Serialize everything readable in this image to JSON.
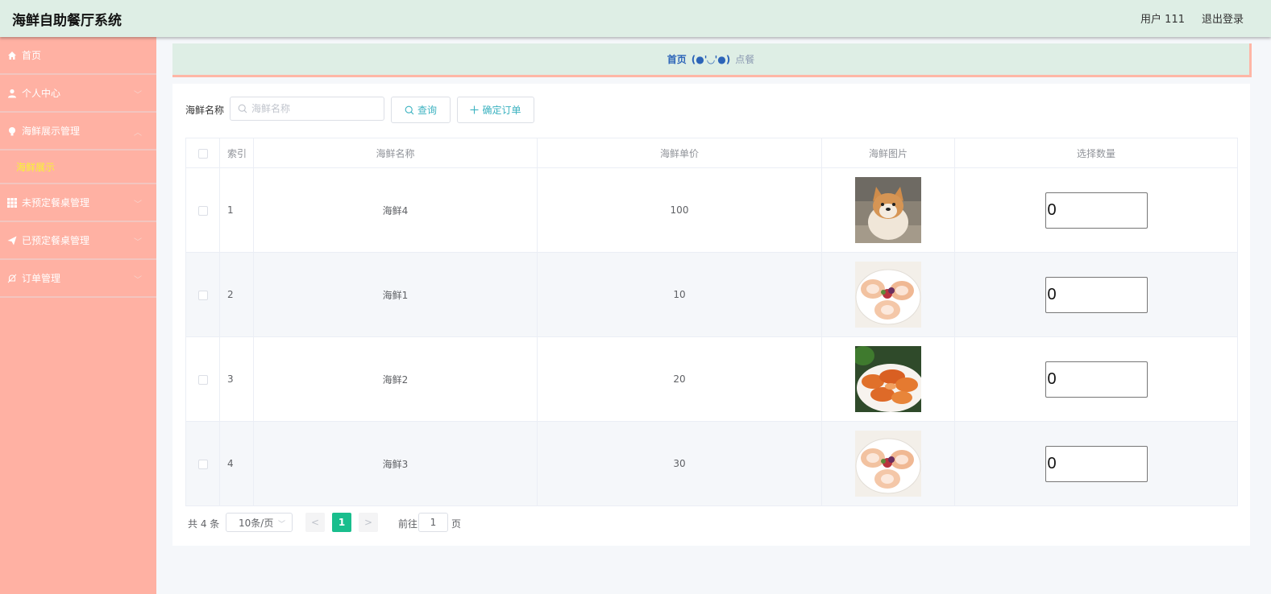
{
  "header": {
    "title": "海鲜自助餐厅系统",
    "user": "用户 111",
    "logout": "退出登录"
  },
  "sidebar": {
    "items": [
      {
        "label": "首页",
        "icon": "home-icon"
      },
      {
        "label": "个人中心",
        "icon": "user-icon"
      },
      {
        "label": "海鲜展示管理",
        "icon": "bulb-icon"
      },
      {
        "label": "未预定餐桌管理",
        "icon": "grid-icon"
      },
      {
        "label": "已预定餐桌管理",
        "icon": "send-icon"
      },
      {
        "label": "订单管理",
        "icon": "bell-off-icon"
      }
    ],
    "subitem": "海鲜展示"
  },
  "breadcrumb": {
    "home": "首页",
    "face": "(●'◡'●)",
    "current": "点餐"
  },
  "search": {
    "label": "海鲜名称",
    "placeholder": "海鲜名称",
    "query_button": "查询",
    "order_button": "确定订单"
  },
  "table": {
    "headers": [
      "索引",
      "海鲜名称",
      "海鲜单价",
      "海鲜图片",
      "选择数量"
    ],
    "rows": [
      {
        "index": "1",
        "name": "海鲜4",
        "price": "100",
        "image": "shiba-dog",
        "qty": "0"
      },
      {
        "index": "2",
        "name": "海鲜1",
        "price": "10",
        "image": "scallop-plate",
        "qty": "0"
      },
      {
        "index": "3",
        "name": "海鲜2",
        "price": "20",
        "image": "shrimp-plate",
        "qty": "0"
      },
      {
        "index": "4",
        "name": "海鲜3",
        "price": "30",
        "image": "scallop-plate",
        "qty": "0"
      }
    ]
  },
  "pagination": {
    "total": "共 4 条",
    "page_size": "10条/页",
    "prev": "<",
    "current": "1",
    "next": ">",
    "goto_label": "前往",
    "goto_value": "1",
    "page_unit": "页"
  },
  "colors": {
    "accent": "#19be8d",
    "sidebar": "#ffb1a3",
    "header": "#deeee5",
    "submenu_active": "#f8f531",
    "link": "#3bb2c0"
  }
}
